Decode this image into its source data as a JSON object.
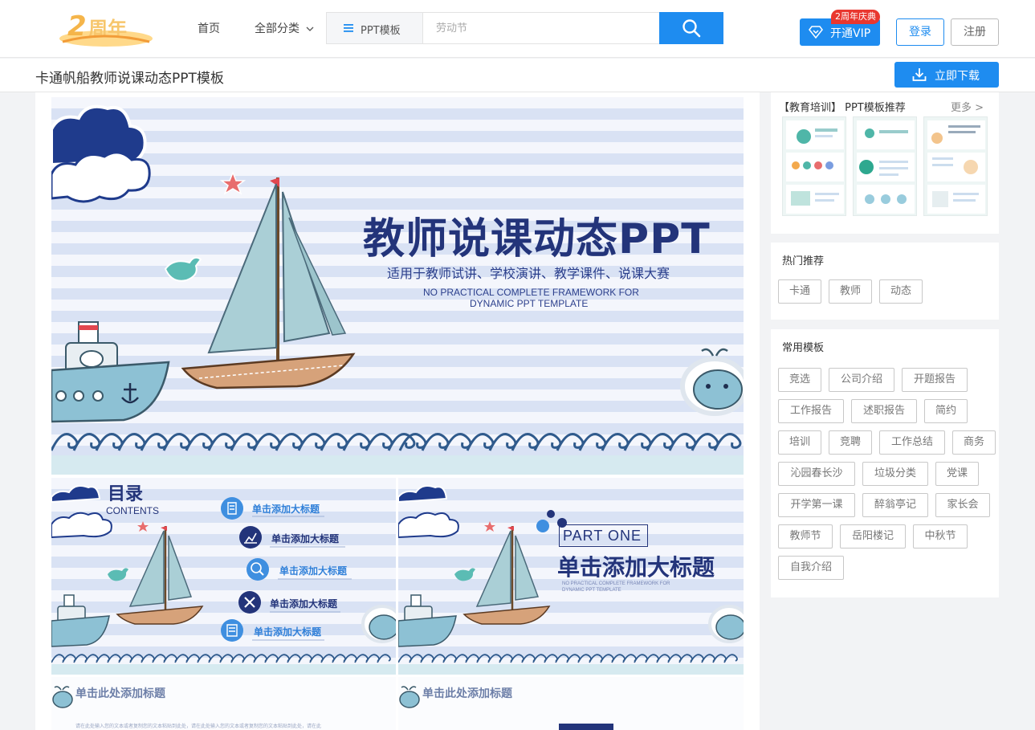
{
  "nav": {
    "links": [
      "首页",
      "全部分类"
    ],
    "search": {
      "type_label": "PPT模板",
      "placeholder": "劳动节"
    },
    "vip": {
      "label": "开通VIP",
      "badge": "2周年庆典"
    },
    "login": "登录",
    "register": "注册"
  },
  "title_bar": {
    "title": "卡通帆船教师说课动态PPT模板",
    "download": "立即下载"
  },
  "preview": {
    "main": {
      "title": "教师说课动态PPT",
      "subtitle": "适用于教师试讲、学校演讲、教学课件、说课大赛",
      "en_line1": "NO PRACTICAL COMPLETE FRAMEWORK FOR",
      "en_line2": "DYNAMIC PPT TEMPLATE"
    },
    "toc": {
      "title": "目录",
      "subtitle": "CONTENTS",
      "items": [
        "单击添加大标题",
        "单击添加大标题",
        "单击添加大标题",
        "单击添加大标题",
        "单击添加大标题"
      ]
    },
    "part": {
      "label": "PART  ONE",
      "title": "单击添加大标题",
      "en_line1": "NO PRACTICAL COMPLETE FRAMEWORK FOR",
      "en_line2": "DYNAMIC PPT TEMPLATE"
    },
    "section_left": {
      "title": "单击此处添加标题",
      "body": "请在此处输入您的文本或者复制您的文本粘贴到此处，请在此处输入您的文本或者复制您的文本粘贴到此处，请在此"
    },
    "section_right": {
      "title": "单击此处添加标题"
    }
  },
  "sidebar": {
    "recommend": {
      "title": "【教育培训】 PPT模板推荐",
      "more": "更多 >"
    },
    "hot": {
      "title": "热门推荐",
      "tags": [
        "卡通",
        "教师",
        "动态"
      ]
    },
    "common": {
      "title": "常用模板",
      "tags": [
        "竞选",
        "公司介绍",
        "开题报告",
        "工作报告",
        "述职报告",
        "简约",
        "培训",
        "竞聘",
        "工作总结",
        "商务",
        "沁园春长沙",
        "垃圾分类",
        "党课",
        "开学第一课",
        "醉翁亭记",
        "家长会",
        "教师节",
        "岳阳楼记",
        "中秋节",
        "自我介绍"
      ]
    }
  },
  "colors": {
    "primary": "#1e8cf0",
    "navy": "#23347a",
    "badge_red": "#e9372f"
  }
}
